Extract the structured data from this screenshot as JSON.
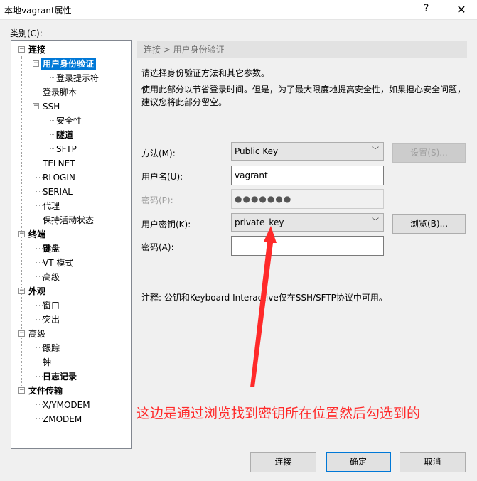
{
  "window": {
    "title": "本地vagrant属性",
    "help_label": "?",
    "close_label": "✕"
  },
  "category_label": "类别(C):",
  "tree": {
    "connection": "连接",
    "user_auth": "用户身份验证",
    "login_prompt": "登录提示符",
    "login_script": "登录脚本",
    "ssh": "SSH",
    "security": "安全性",
    "tunnel": "隧道",
    "sftp": "SFTP",
    "telnet": "TELNET",
    "rlogin": "RLOGIN",
    "serial": "SERIAL",
    "proxy": "代理",
    "keepalive": "保持活动状态",
    "terminal": "终端",
    "keyboard": "键盘",
    "vt_mode": "VT 模式",
    "terminal_advanced": "高级",
    "appearance": "外观",
    "window": "窗口",
    "highlight": "突出",
    "advanced": "高级",
    "trace": "跟踪",
    "bell": "钟",
    "logging": "日志记录",
    "file_transfer": "文件传输",
    "xymodem": "X/YMODEM",
    "zmodem": "ZMODEM"
  },
  "breadcrumb": "连接 > 用户身份验证",
  "description": {
    "line1": "请选择身份验证方法和其它参数。",
    "line2": "使用此部分以节省登录时间。但是，为了最大限度地提高安全性，如果担心安全问题，",
    "line3": "建议您将此部分留空。"
  },
  "form": {
    "method_label": "方法(M):",
    "method_value": "Public Key",
    "settings_button": "设置(S)...",
    "username_label": "用户名(U):",
    "username_value": "vagrant",
    "password_label": "密码(P):",
    "password_value": "●●●●●●●",
    "user_key_label": "用户密钥(K):",
    "user_key_value": "private_key",
    "browse_button": "浏览(B)...",
    "passphrase_label": "密码(A):",
    "passphrase_value": ""
  },
  "note": "注释: 公钥和Keyboard Interactive仅在SSH/SFTP协议中可用。",
  "annotation": "这边是通过浏览找到密钥所在位置然后勾选到的",
  "buttons": {
    "connect": "连接",
    "ok": "确定",
    "cancel": "取消"
  },
  "colors": {
    "selection": "#0078d7",
    "annotation": "#ff2a2a"
  }
}
